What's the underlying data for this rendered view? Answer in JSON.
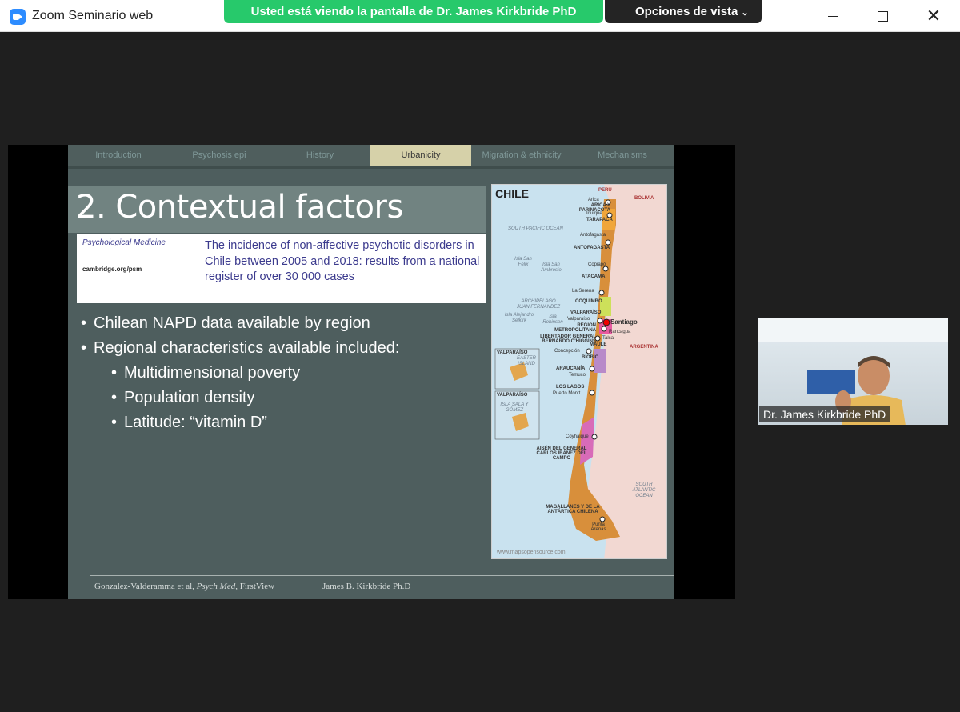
{
  "window": {
    "app_title": "Zoom Seminario web",
    "share_banner": "Usted está viendo la pantalla de Dr. James Kirkbride PhD",
    "view_options": "Opciones de vista",
    "controls": {
      "minimize_icon": "minimize-icon",
      "maximize_icon": "maximize-icon",
      "close_icon": "close-icon"
    },
    "colors": {
      "banner": "#27c96b",
      "view_options": "#242424",
      "zoom_blue": "#2d8cff"
    }
  },
  "slide": {
    "nav_tabs": [
      {
        "label": "Introduction",
        "active": false
      },
      {
        "label": "Psychosis epi",
        "active": false
      },
      {
        "label": "History",
        "active": false
      },
      {
        "label": "Urbanicity",
        "active": true
      },
      {
        "label": "Migration & ethnicity",
        "active": false
      },
      {
        "label": "Mechanisms",
        "active": false
      }
    ],
    "title": "2. Contextual factors",
    "paper": {
      "journal": "Psychological Medicine",
      "site": "cambridge.org/psm",
      "title": "The incidence of non-affective psychotic disorders in Chile between 2005 and 2018: results from a national register of over 30 000 cases"
    },
    "bullets": [
      {
        "text": "Chilean NAPD data available by region",
        "level": 1
      },
      {
        "text": "Regional characteristics available included:",
        "level": 1
      },
      {
        "text": "Multidimensional poverty",
        "level": 2
      },
      {
        "text": "Population density",
        "level": 2
      },
      {
        "text": "Latitude: “vitamin D”",
        "level": 2
      }
    ],
    "map": {
      "title": "CHILE",
      "credit": "www.mapsopensource.com",
      "countries": [
        "PERU",
        "BOLIVIA",
        "ARGENTINA"
      ],
      "oceans": [
        "SOUTH PACIFIC OCEAN",
        "SOUTH ATLANTIC OCEAN"
      ],
      "regions": [
        "ARICA Y PARINACOTA",
        "TARAPACÁ",
        "ANTOFAGASTA",
        "ATACAMA",
        "COQUIMBO",
        "VALPARAÍSO",
        "REGIÓN METROPOLITANA",
        "LIBERTADOR GENERAL BERNARDO O'HIGGINS",
        "MAULE",
        "BIOBÍO",
        "ARAUCANÍA",
        "LOS LAGOS",
        "AISÉN DEL GENERAL CARLOS IBAÑEZ DEL CAMPO",
        "MAGALLANES Y DE LA ANTÁRTICA CHILENA"
      ],
      "cities": [
        "Arica",
        "Iquique",
        "Antofagasta",
        "Copiapó",
        "La Serena",
        "Valparaíso",
        "Santiago",
        "Rancagua",
        "Talca",
        "Concepción",
        "Temuco",
        "Puerto Montt",
        "Coyhaique",
        "Punta Arenas"
      ],
      "islands": [
        "Isla San Felix",
        "Isla San Ambrosio",
        "ARCHIPELAGO JUAN FERNÁNDEZ",
        "Isla Alejandro Selkirk",
        "Isla Robinson",
        "EASTER ISLAND",
        "ISLA SALA Y GÓMEZ"
      ],
      "inset_labels": [
        "VALPARAÍSO",
        "VALPARAÍSO"
      ]
    },
    "footer_left_author": "Gonzalez-Valderamma et al, ",
    "footer_left_journal": "Psych Med",
    "footer_left_tail": ", FirstView",
    "footer_right": "James B. Kirkbride Ph.D"
  },
  "speaker": {
    "name": "Dr. James Kirkbride PhD"
  }
}
